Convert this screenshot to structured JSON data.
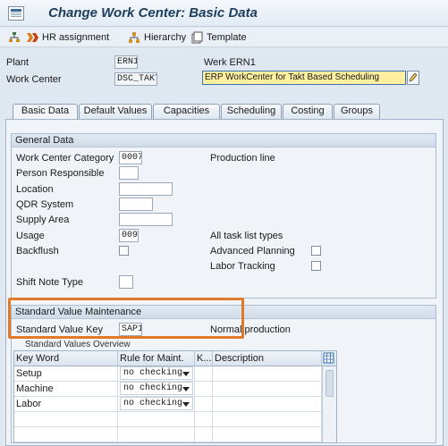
{
  "window": {
    "title": "Change Work Center: Basic Data"
  },
  "toolbar": {
    "hr_assignment": "HR assignment",
    "hierarchy": "Hierarchy",
    "template": "Template"
  },
  "header": {
    "plant_label": "Plant",
    "plant_value": "ERN1",
    "plant_desc": "Werk ERN1",
    "work_center_label": "Work Center",
    "work_center_value": "DSC_TAKT",
    "work_center_desc": "ERP WorkCenter for Takt Based Scheduling"
  },
  "tabs": [
    "Basic Data",
    "Default Values",
    "Capacities",
    "Scheduling",
    "Costing",
    "Groups"
  ],
  "general_data": {
    "title": "General Data",
    "category_label": "Work Center Category",
    "category_value": "0007",
    "category_desc": "Production line",
    "person_label": "Person Responsible",
    "person_value": "",
    "location_label": "Location",
    "location_value": "",
    "qdr_label": "QDR System",
    "qdr_value": "",
    "supply_label": "Supply Area",
    "supply_value": "",
    "usage_label": "Usage",
    "usage_value": "009",
    "usage_desc": "All task list types",
    "backflush_label": "Backflush",
    "advanced_planning_label": "Advanced Planning",
    "labor_tracking_label": "Labor Tracking",
    "shift_note_label": "Shift Note Type",
    "shift_note_value": ""
  },
  "std_value": {
    "title": "Standard Value Maintenance",
    "key_label": "Standard Value Key",
    "key_value": "SAP1",
    "key_desc": "Normal production",
    "overview_title": "Standard Values Overview",
    "columns": [
      "Key Word",
      "Rule for Maint.",
      "K...",
      "Description"
    ],
    "rows": [
      {
        "key_word": "Setup",
        "rule": "no checking"
      },
      {
        "key_word": "Machine",
        "rule": "no checking"
      },
      {
        "key_word": "Labor",
        "rule": "no checking"
      }
    ]
  },
  "colors": {
    "highlight_field": "#ffef9f",
    "annotation_box": "#e07a2a",
    "title_text": "#1b3e5e"
  }
}
